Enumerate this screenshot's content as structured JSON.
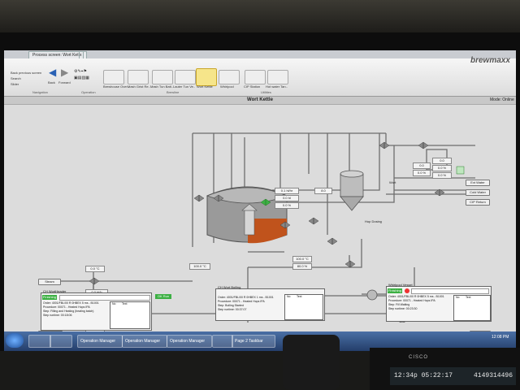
{
  "window": {
    "tabs": [
      "Process screen: Wort Kettle",
      "x"
    ],
    "brand": "brewmaxx",
    "page_title": "Wort Kettle",
    "mode": "Mode: Online"
  },
  "ribbon": {
    "nav_items": [
      "Back previous screen",
      "Search",
      "Slider"
    ],
    "nav_group": "Navigation",
    "back_label": "Back",
    "forward_label": "Forward",
    "operation_group": "Operation",
    "big_buttons": [
      "Brewhouse Over..",
      "Mash Grist Re..",
      "Mash Tun Batt..",
      "Lauter Tun Ve..",
      "Wort Kettle",
      "Whirlpool",
      "CIP Station",
      "Hot water Tan.."
    ],
    "brewline_group": "Brewline",
    "utilities_group": "Utilities"
  },
  "process": {
    "top_tags": [
      "0.0",
      "0.0 %",
      "0.0",
      "0.0 %",
      "0.0 %"
    ],
    "valve_status": "0.0 hl/h",
    "small_tags": [
      "8.0",
      "0.1 hl/hr",
      "0.0 hl",
      "0.0 %",
      "100.0 %"
    ],
    "whirlpool_label": "Hop Dosing",
    "kettle_temp": "100.0 °C",
    "kettle_side_tags": [
      "100.0 °C",
      "80.0 %"
    ],
    "left_tags": [
      "0.0 °C",
      "0.0 hl/h",
      "76.8 °C",
      "14.4 °C",
      "0.4 °C"
    ],
    "steam_label": "Steam",
    "lauter_label": "Lauter Tun",
    "right_buttons": [
      "Ext Water",
      "Cold Water",
      "CIP Return"
    ],
    "wort_label": "Wort",
    "outlets": [
      "Ldrt",
      "Whirlpool",
      "3.0 °C"
    ],
    "stir_label": "OK Run"
  },
  "panels": {
    "left": {
      "title": "CH WortHeader",
      "status": "Finishing",
      "lines": [
        "Order: 4001/FBL/00 R 0HBEX 5 ms - B1001",
        "Procedure: 00071 - Heated Hops IPA",
        "Step: Filling and Heating (heating batch)",
        "Step runtime: 00:18:06"
      ],
      "note_headers": [
        "No",
        "Text"
      ]
    },
    "mid": {
      "title": "CH Wort Boiling",
      "lines": [
        "Order: 4001/FBL/00 R 0HBEX 1 ms - B1001",
        "Procedure: 00071 - Heated Hops IPA",
        "Step: Boiling Started",
        "Step runtime: 00:37:07"
      ],
      "note_headers": [
        "No",
        "Text"
      ]
    },
    "right": {
      "title": "Whirlpool Vessel",
      "status": "Finishing",
      "lines": [
        "Order: 4001/FBL/00 R 0HBEX 5 ms - B1001",
        "Procedure: 00071 - Heated Hops IPA",
        "Step: Fill Waiting",
        "Step runtime: 00:23:30"
      ],
      "note_headers": [
        "No",
        "Text"
      ]
    },
    "ok_badge": "OK Run"
  },
  "taskbar": {
    "items": [
      "",
      "",
      "Operation Manager",
      "Operation Manager",
      "Operation Manager",
      "",
      "Page 2 Taskbar"
    ],
    "clock": "12:08 PM"
  },
  "phone": {
    "brand": "CISCO",
    "time": "12:34p 05:22:17",
    "number": "4149314496"
  },
  "colors": {
    "kettle_fill": "#c0531c",
    "valve_green": "#3cb043",
    "screen_bg": "#dcdcdc",
    "pipe": "#7a7a7a"
  }
}
